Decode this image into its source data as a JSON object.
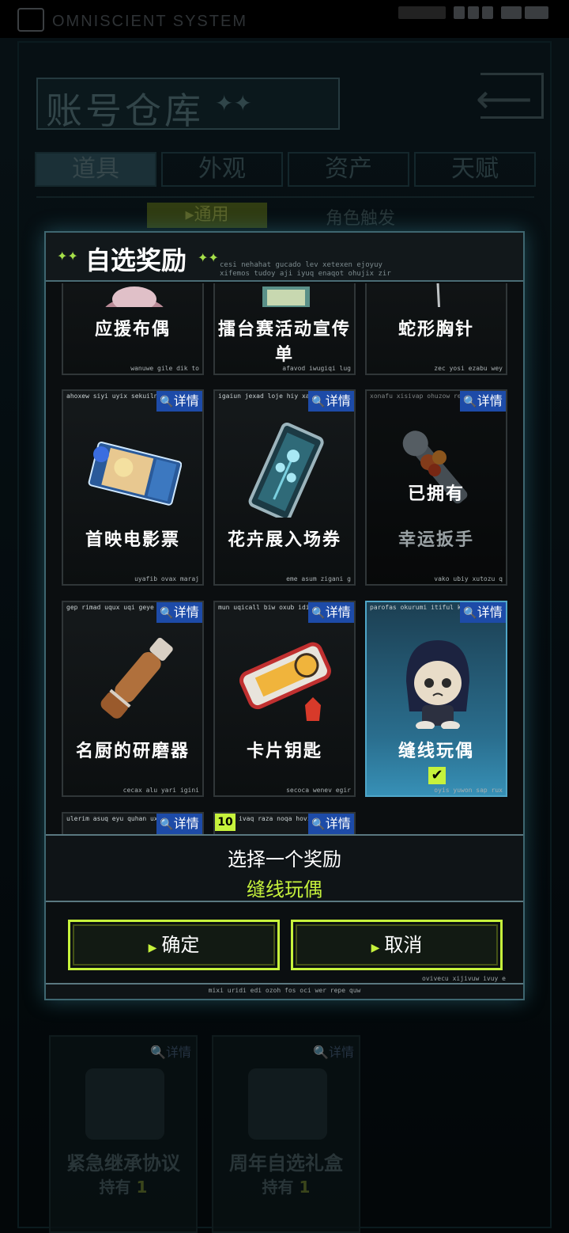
{
  "status_bar": {
    "system_text": "OMNISCIENT SYSTEM"
  },
  "background": {
    "title": "账号仓库",
    "title_stars": "✦✦",
    "tabs": [
      "道具",
      "外观",
      "资产",
      "天赋"
    ],
    "subtabs": [
      "▸通用",
      "角色触发"
    ],
    "cards": [
      {
        "name": "紧急继承协议",
        "own_label": "持有",
        "own_count": "1",
        "detail": "🔍详情"
      },
      {
        "name": "周年自选礼盒",
        "own_label": "持有",
        "own_count": "1",
        "detail": "🔍详情"
      }
    ]
  },
  "modal": {
    "title": "自选奖励",
    "title_stars": "✦✦",
    "head_sub_line1": "cesi nehahat gucado lev xetexen ejoyuy",
    "head_sub_line2": "xifemos tudoy aji iyuq enaqot ohujix zir",
    "detail_label": "详情",
    "owned_label": "已拥有",
    "items": [
      {
        "name": "应援布偶",
        "tag": "",
        "foot": "wanuwe gile dik to",
        "owned": false,
        "selected": false
      },
      {
        "name": "擂台赛活动宣传单",
        "tag": "",
        "foot": "afavod iwugiqi lug",
        "owned": false,
        "selected": false
      },
      {
        "name": "蛇形胸针",
        "tag": "",
        "foot": "zec yosi ezabu wey",
        "owned": false,
        "selected": false
      },
      {
        "name": "首映电影票",
        "tag": "ahoxew siyi uyix sekuiln jo",
        "foot": "uyafib ovax maraj",
        "owned": false,
        "selected": false
      },
      {
        "name": "花卉展入场券",
        "tag": "igaiun jexad loje hiy xaj fu",
        "foot": "eme asum zigani g",
        "owned": false,
        "selected": false
      },
      {
        "name": "幸运扳手",
        "tag": "xonafu xisivap ohuzow rex",
        "foot": "vako ubiy xutozu q",
        "owned": true,
        "selected": false
      },
      {
        "name": "名厨的研磨器",
        "tag": "gep rimad uqux uqi geye ju",
        "foot": "cecax alu yari igini",
        "owned": false,
        "selected": false
      },
      {
        "name": "卡片钥匙",
        "tag": "mun uqicall biw oxub idip l",
        "foot": "secoca wenev egir",
        "owned": false,
        "selected": false
      },
      {
        "name": "缝线玩偶",
        "tag": "parofas okurumi itiful keyir",
        "foot": "oyis yuwon sap rux",
        "owned": false,
        "selected": true
      },
      {
        "name": "",
        "tag": "ulerim asuq eyu quhan uxu",
        "foot": "",
        "owned": false,
        "selected": false
      },
      {
        "name": "",
        "tag": "ivaq raza noqa hovini",
        "foot": "",
        "owned": false,
        "selected": false,
        "qty": "10"
      }
    ],
    "prompt": "选择一个奖励",
    "chosen": "缝线玩偶",
    "confirm": "确定",
    "cancel": "取消",
    "foot_note": "ovivecu xijivuw ivuy e",
    "bottom_note": "mixi uridi edi ozoh fos oci wer repe quw",
    "accent_color": "#c6f23c",
    "detail_color": "#1d4ba8"
  }
}
